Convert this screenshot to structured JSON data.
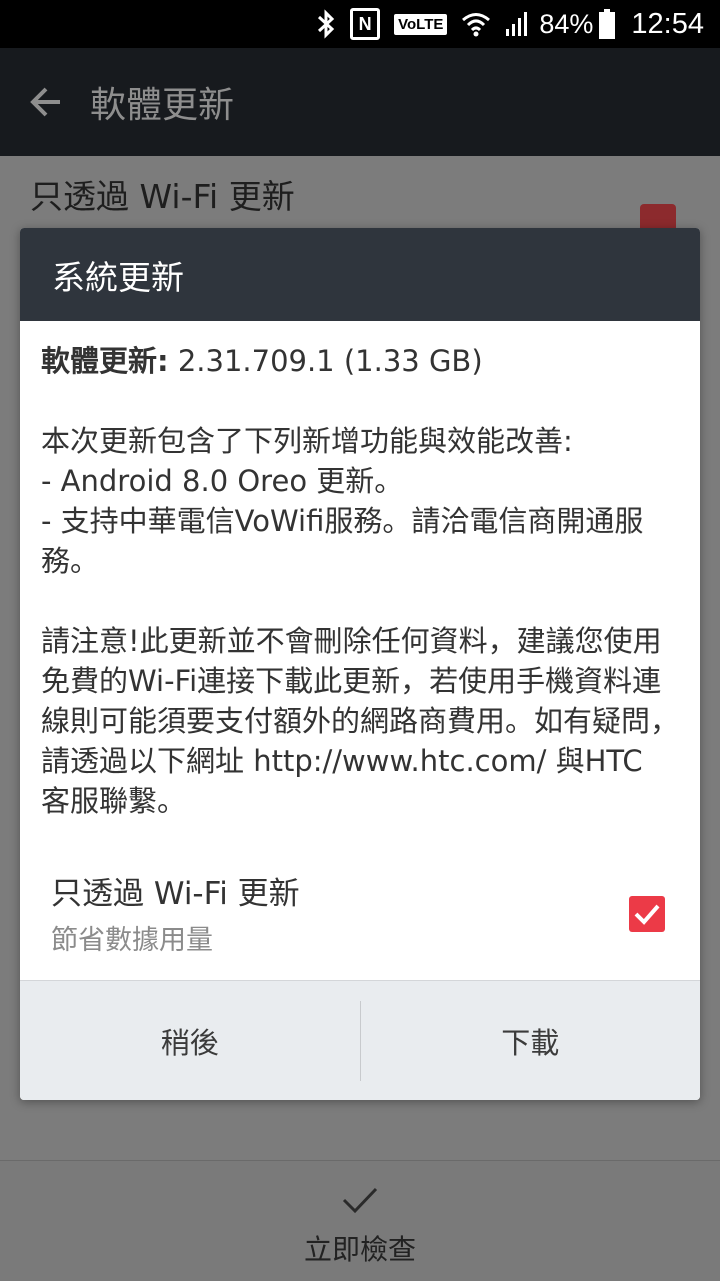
{
  "status_bar": {
    "icons": [
      "bluetooth-icon",
      "nfc-icon",
      "volte-badge",
      "wifi-icon",
      "signal-icon",
      "battery-icon"
    ],
    "volte": "VoLTE",
    "nfc": "N",
    "battery": "84%",
    "time": "12:54"
  },
  "app_bar": {
    "title": "軟體更新"
  },
  "underlying": {
    "wifi_only_label": "只透過 Wi-Fi 更新",
    "check_now_label": "立即檢查"
  },
  "dialog": {
    "title": "系統更新",
    "version_label": "軟體更新:",
    "version_value": " 2.31.709.1 (1.33 GB)",
    "notes_intro": "本次更新包含了下列新增功能與效能改善:",
    "notes_item_1": "- Android 8.0 Oreo 更新。",
    "notes_item_2": "- 支持中華電信VoWifi服務。請洽電信商開通服務。",
    "notice": "請注意!此更新並不會刪除任何資料，建議您使用免費的Wi-Fi連接下載此更新，若使用手機資料連線則可能須要支付額外的網路商費用。如有疑問，請透過以下網址 http://www.htc.com/  與HTC 客服聯繫。",
    "wifi_option": {
      "title": "只透過 Wi-Fi 更新",
      "subtitle": "節省數據用量",
      "checked": true
    },
    "buttons": {
      "later": "稍後",
      "download": "下載"
    }
  },
  "colors": {
    "accent_red": "#ec3a47",
    "dialog_header": "#2f353d"
  }
}
